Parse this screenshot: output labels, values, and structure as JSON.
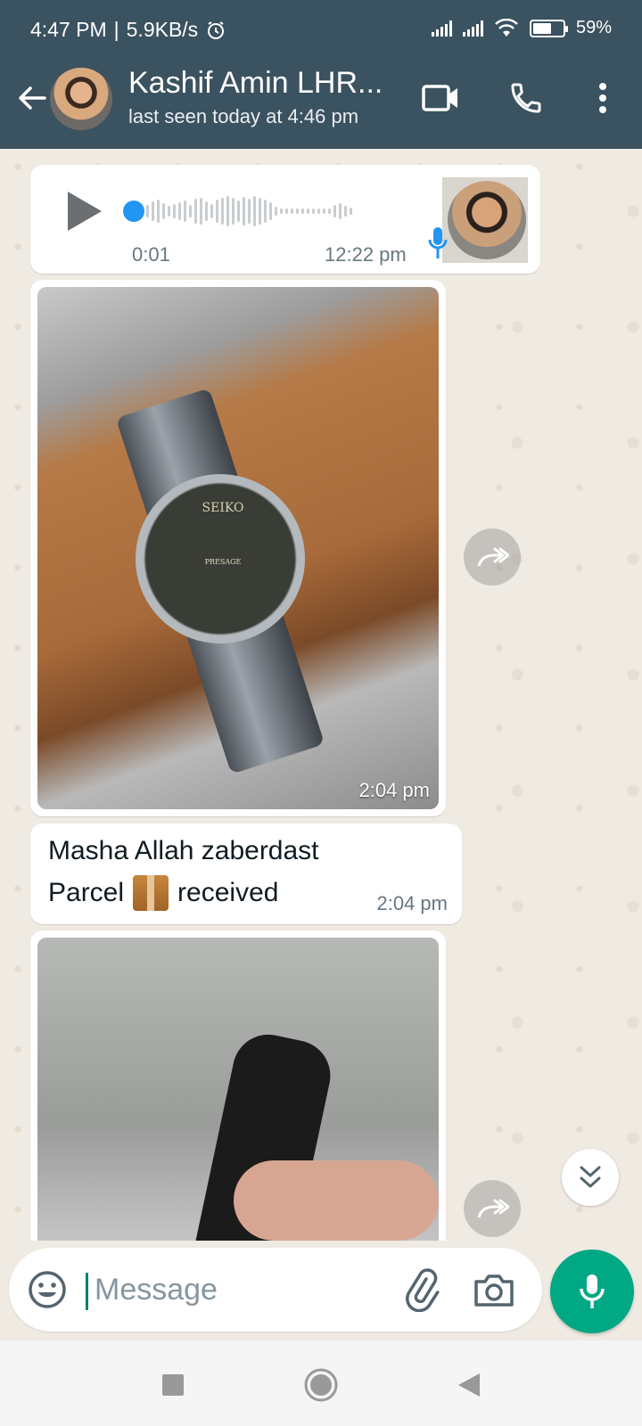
{
  "status_bar": {
    "time": "4:47 PM",
    "separator": "|",
    "net_speed": "5.9KB/s",
    "battery": "59%",
    "icons": [
      "alarm-icon",
      "signal-icon",
      "signal-icon",
      "wifi-icon",
      "battery-icon"
    ]
  },
  "header": {
    "contact_name": "Kashif Amin LHR...",
    "last_seen": "last seen today at 4:46 pm",
    "icons": [
      "back-arrow-icon",
      "video-call-icon",
      "voice-call-icon",
      "more-vertical-icon"
    ]
  },
  "messages": [
    {
      "type": "voice",
      "duration": "0:01",
      "time": "12:22 pm",
      "played_fraction": 0.0
    },
    {
      "type": "image",
      "image_text_brand": "SEIKO",
      "image_text_model": "PRESAGE",
      "time": "2:04 pm"
    },
    {
      "type": "text",
      "line1": "Masha Allah zaberdast",
      "line2_before": "Parcel",
      "line2_emoji": "package-icon",
      "line2_after": "received",
      "time": "2:04 pm"
    },
    {
      "type": "image",
      "time": ""
    }
  ],
  "input": {
    "placeholder": "Message",
    "value": "",
    "icons": [
      "emoji-icon",
      "attach-icon",
      "camera-icon",
      "mic-icon"
    ]
  },
  "colors": {
    "header": "#3b5260",
    "accent": "#00a884",
    "chat_bg": "#efeae2",
    "voice_progress": "#2196f3"
  },
  "nav": {
    "icons": [
      "recents-icon",
      "home-icon",
      "back-icon"
    ]
  }
}
